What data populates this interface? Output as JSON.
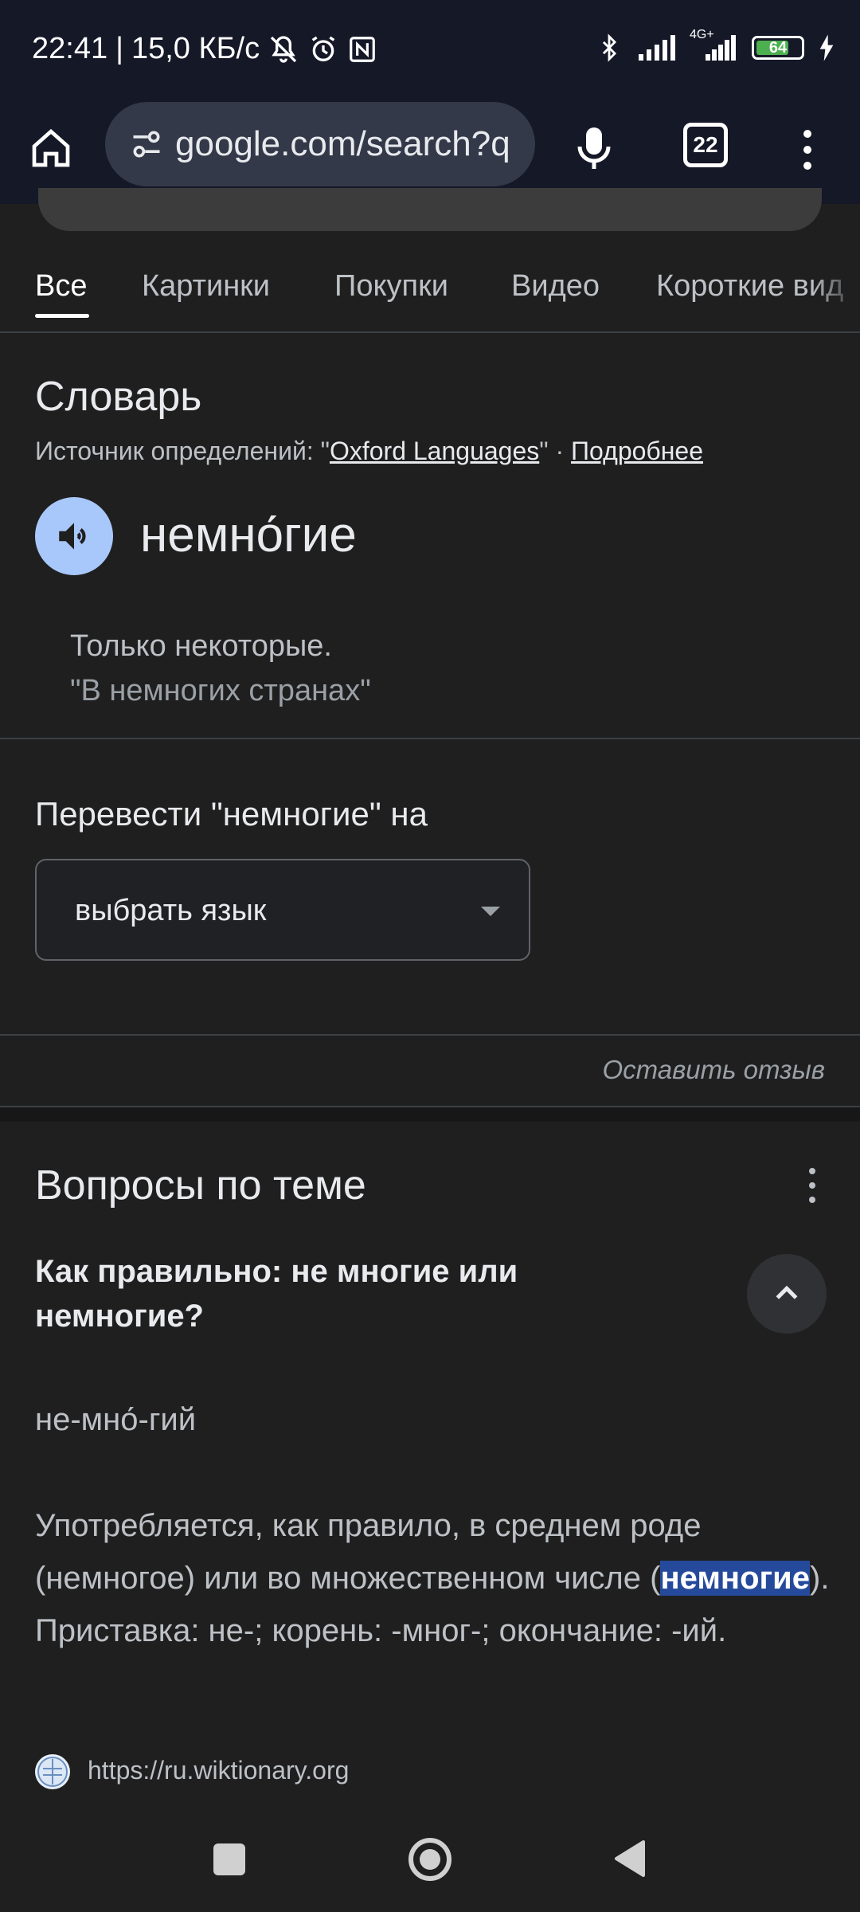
{
  "status_bar": {
    "time": "22:41",
    "speed": "15,0 КБ/с",
    "network": "4G+",
    "battery": "64",
    "icons": [
      "mute-bell-icon",
      "alarm-icon",
      "nfc-icon",
      "bluetooth-icon",
      "signal-icon",
      "signal-4g-icon",
      "battery-icon",
      "charging-icon"
    ]
  },
  "toolbar": {
    "url": "google.com/search?q",
    "tab_count": "22"
  },
  "tabs": [
    {
      "label": "Все",
      "active": true
    },
    {
      "label": "Картинки"
    },
    {
      "label": "Покупки"
    },
    {
      "label": "Видео"
    },
    {
      "label": "Короткие вид"
    }
  ],
  "dictionary": {
    "title": "Словарь",
    "source_prefix": "Источник определений: \"",
    "source_link": "Oxford Languages",
    "source_sep": "\" · ",
    "more_link": "Подробнее",
    "word": "немно́гие",
    "definition": "Только некоторые.",
    "example": "\"В немногих странах\""
  },
  "translate": {
    "label": "Перевести \"немногие\" на",
    "select_value": "выбрать язык"
  },
  "feedback": "Оставить отзыв",
  "paa": {
    "title": "Вопросы по теме",
    "question": "Как правильно: не многие или немногие?",
    "syllables": "не-мно́-гий",
    "answer_before": "Употребляется, как правило, в среднем роде (немногое) или во множественном числе (",
    "answer_highlight": "немногие",
    "answer_after": "). Приставка: не-; корень: -мног-; окончание: -ий.",
    "source_url": "https://ru.wiktionary.org"
  },
  "colors": {
    "accent": "#a8c7fa",
    "highlight": "#264a9b",
    "background": "#1f1f1f",
    "toolbar": "#151827"
  }
}
